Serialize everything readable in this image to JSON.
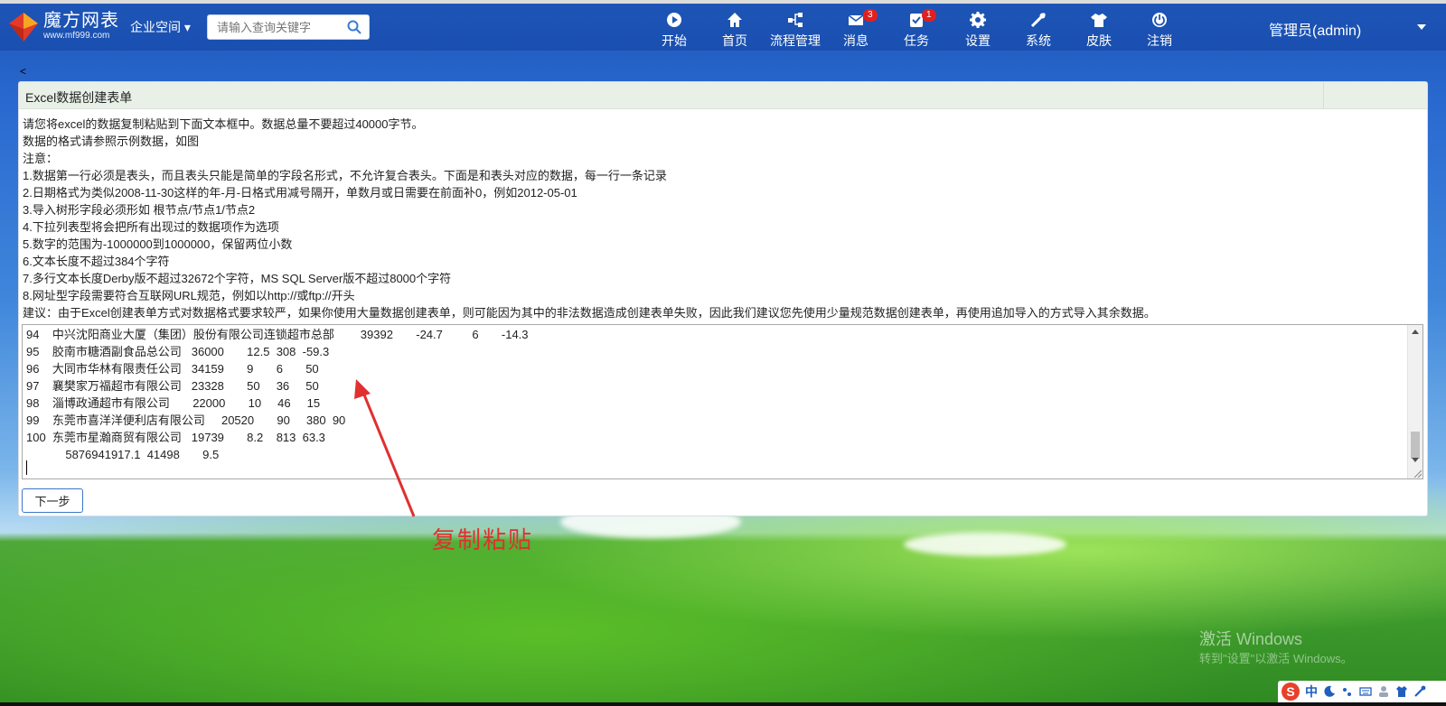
{
  "header": {
    "brand_name": "魔方网表",
    "brand_url": "www.mf999.com",
    "space_menu": "企业空间",
    "search_placeholder": "请输入查询关键字",
    "nav": [
      {
        "label": "开始",
        "icon": "play-icon"
      },
      {
        "label": "首页",
        "icon": "home-icon"
      },
      {
        "label": "流程管理",
        "icon": "workflow-icon"
      },
      {
        "label": "消息",
        "icon": "mail-icon",
        "badge": "3"
      },
      {
        "label": "任务",
        "icon": "task-icon",
        "badge": "1"
      },
      {
        "label": "设置",
        "icon": "gear-icon"
      },
      {
        "label": "系统",
        "icon": "tools-icon"
      },
      {
        "label": "皮肤",
        "icon": "shirt-icon"
      },
      {
        "label": "注销",
        "icon": "power-icon"
      }
    ],
    "user": "管理员(admin)"
  },
  "back_mark": "<",
  "panel": {
    "title": "Excel数据创建表单",
    "instructions": [
      "请您将excel的数据复制粘贴到下面文本框中。数据总量不要超过40000字节。",
      "数据的格式请参照示例数据，如图",
      "注意：",
      "1.数据第一行必须是表头，而且表头只能是简单的字段名形式，不允许复合表头。下面是和表头对应的数据，每一行一条记录",
      "2.日期格式为类似2008-11-30这样的年-月-日格式用减号隔开，单数月或日需要在前面补0，例如2012-05-01",
      "3.导入树形字段必须形如 根节点/节点1/节点2",
      "4.下拉列表型将会把所有出现过的数据项作为选项",
      "5.数字的范围为-1000000到1000000，保留两位小数",
      "6.文本长度不超过384个字符",
      "7.多行文本长度Derby版不超过32672个字符，MS SQL Server版不超过8000个字符",
      "8.网址型字段需要符合互联网URL规范，例如以http://或ftp://开头",
      "建议：由于Excel创建表单方式对数据格式要求较严，如果你使用大量数据创建表单，则可能因为其中的非法数据造成创建表单失败，因此我们建议您先使用少量规范数据创建表单，再使用追加导入的方式导入其余数据。"
    ],
    "textarea_lines": [
      "94    中兴沈阳商业大厦（集团）股份有限公司连锁超市总部        39392       -24.7         6       -14.3",
      "95    胶南市糖酒副食品总公司   36000       12.5  308  -59.3",
      "96    大同市华林有限责任公司   34159       9       6       50",
      "97    襄樊家万福超市有限公司   23328       50     36     50",
      "98    淄博政通超市有限公司       22000       10     46     15",
      "99    东莞市喜洋洋便利店有限公司     20520       90     380  90",
      "100  东莞市星瀚商贸有限公司   19739       8.2    813  63.3",
      "            5876941917.1  41498       9.5"
    ],
    "next_button": "下一步"
  },
  "annotation": "复制粘贴",
  "watermark": {
    "line1": "激活 Windows",
    "line2": "转到\"设置\"以激活 Windows。"
  },
  "ime": {
    "logo": "S",
    "mode": "中"
  },
  "colors": {
    "header_bg": "#1d55b6",
    "badge": "#e02020",
    "annotation": "#e03030",
    "panel_head_bg": "#e8f0e8"
  }
}
